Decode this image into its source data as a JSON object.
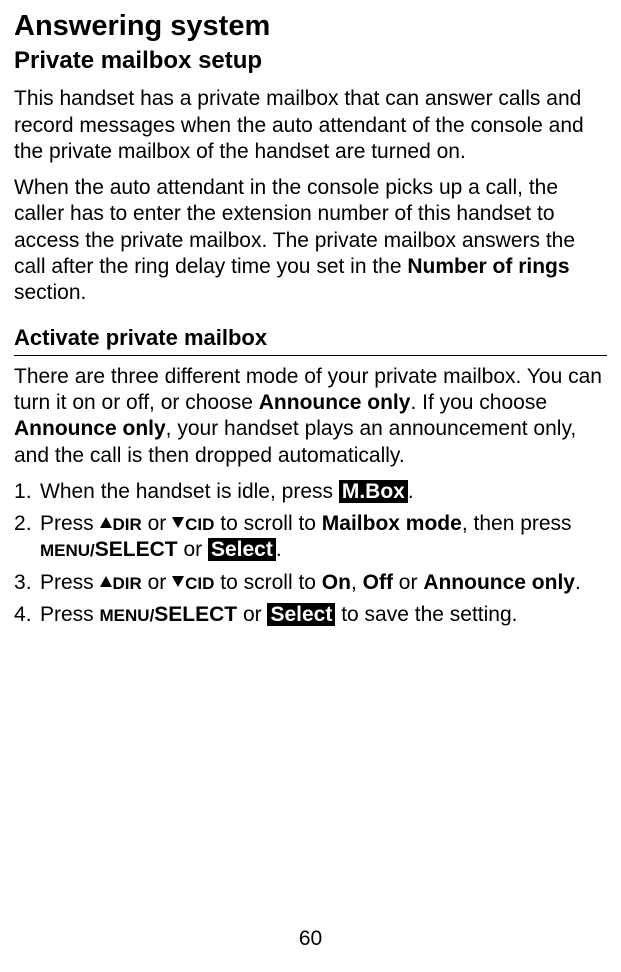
{
  "title": "Answering system",
  "subtitle": "Private mailbox setup",
  "para1": "This handset has a private mailbox that can answer calls and record messages when the auto attendant of the console and the private mailbox of the handset are turned on.",
  "para2_a": "When the auto attendant in the console picks up a call, the caller has to enter the extension number of this handset to access the private mailbox. The private mailbox answers the call after the ring delay time you set in the ",
  "para2_bold": "Number of rings",
  "para2_b": " section.",
  "section_header": "Activate private mailbox",
  "para3_a": "There are three different mode of your private mailbox. You can turn it on or off, or choose ",
  "para3_b1": "Announce only",
  "para3_b": ". If you choose ",
  "para3_b2": "Announce only",
  "para3_c": ", your handset plays an announcement only, and the call is then dropped automatically.",
  "step1_a": "When the handset is idle, press ",
  "step1_inv": "M.Box",
  "step1_b": ".",
  "step2_a": "Press ",
  "step2_dir": "DIR",
  "step2_or1": " or ",
  "step2_cid": "CID",
  "step2_b": " to scroll to ",
  "step2_bold": "Mailbox mode",
  "step2_c": ", then press ",
  "step2_menu": "MENU/",
  "step2_select": "SELECT",
  "step2_or2": " or ",
  "step2_inv": "Select",
  "step2_d": ".",
  "step3_a": "Press ",
  "step3_dir": "DIR",
  "step3_or": " or ",
  "step3_cid": "CID",
  "step3_b": " to scroll to ",
  "step3_on": "On",
  "step3_c": ", ",
  "step3_off": "Off",
  "step3_d": " or ",
  "step3_ao": "Announce only",
  "step3_e": ".",
  "step4_a": "Press ",
  "step4_menu": "MENU/",
  "step4_select": "SELECT",
  "step4_or": " or ",
  "step4_inv": "Select",
  "step4_b": " to save the setting.",
  "page_number": "60"
}
